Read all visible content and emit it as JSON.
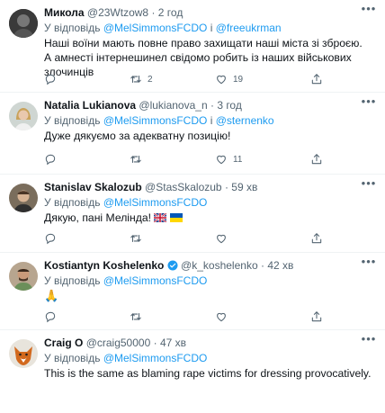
{
  "tweets": [
    {
      "name": "Микола",
      "handle": "@23Wtzow8",
      "time": "2 год",
      "reply_prefix": "У відповідь",
      "reply_1": "@MelSimmonsFCDO",
      "reply_sep": "і",
      "reply_2": "@freeukrman",
      "text": "Наші воїни мають повне право захищати наші міста зі зброєю. А амнесті інтернешинел свідомо робить із наших військових злочинців",
      "retweets": "2",
      "likes": "19"
    },
    {
      "name": "Natalia Lukianova",
      "handle": "@lukianova_n",
      "time": "3 год",
      "reply_prefix": "У відповідь",
      "reply_1": "@MelSimmonsFCDO",
      "reply_sep": "і",
      "reply_2": "@sternenko",
      "text": "Дуже дякуємо за адекватну позицію!",
      "retweets": "",
      "likes": "11"
    },
    {
      "name": "Stanislav Skalozub",
      "handle": "@StasSkalozub",
      "time": "59 хв",
      "reply_prefix": "У відповідь",
      "reply_1": "@MelSimmonsFCDO",
      "text": "Дякую, пані Мелінда!",
      "retweets": "",
      "likes": ""
    },
    {
      "name": "Kostiantyn Koshelenko",
      "handle": "@k_koshelenko",
      "time": "42 хв",
      "reply_prefix": "У відповідь",
      "reply_1": "@MelSimmonsFCDO",
      "text": "🙏",
      "retweets": "",
      "likes": ""
    },
    {
      "name": "Craig O",
      "handle": "@craig50000",
      "time": "47 хв",
      "reply_prefix": "У відповідь",
      "reply_1": "@MelSimmonsFCDO",
      "text": "This is the same as blaming rape victims for dressing provocatively.",
      "retweets": "",
      "likes": ""
    }
  ],
  "icons": {
    "more": "more-options-icon",
    "reply": "reply-icon",
    "retweet": "retweet-icon",
    "like": "like-icon",
    "share": "share-icon",
    "verified": "verified-badge-icon"
  },
  "colors": {
    "link": "#1d9bf0",
    "muted": "#536471",
    "text": "#0f1419",
    "divider": "#eff3f4"
  }
}
